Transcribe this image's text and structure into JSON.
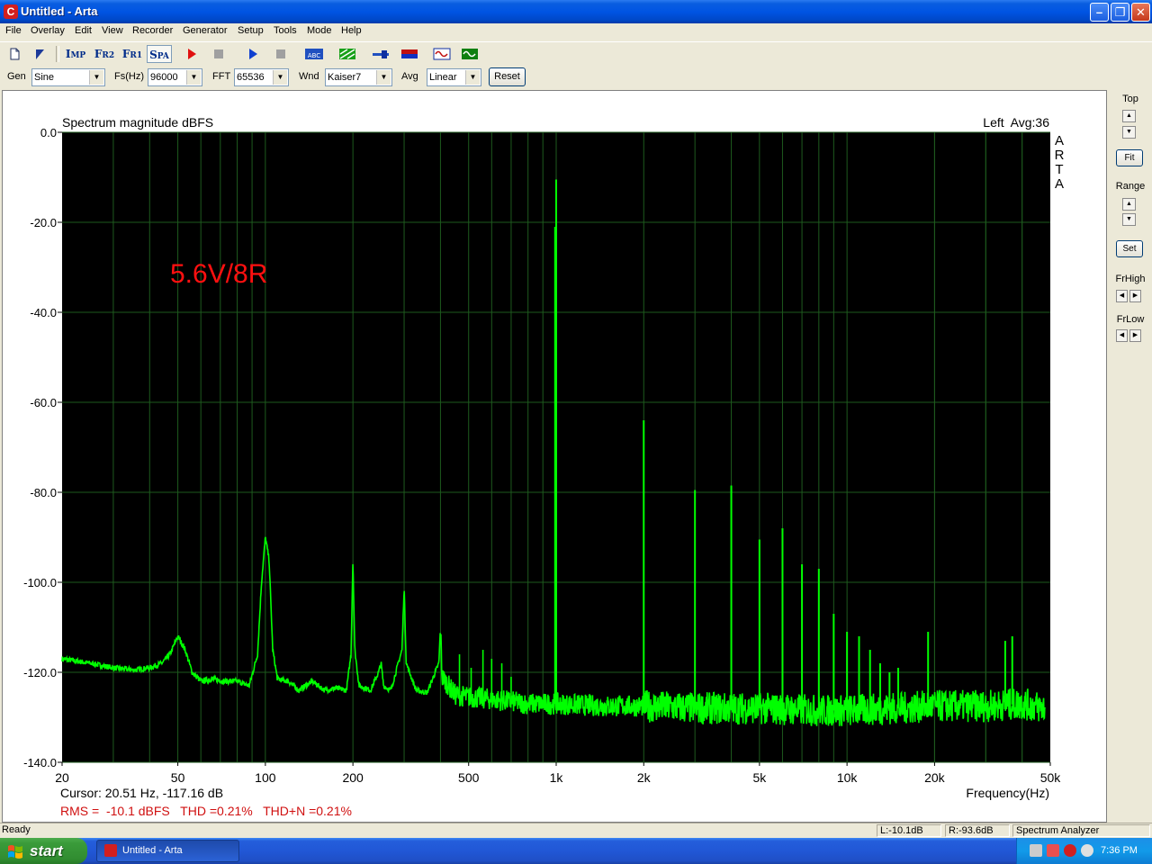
{
  "window": {
    "title": "Untitled - Arta",
    "app_icon_letter": "C",
    "minimize_glyph": "–",
    "maximize_glyph": "❐",
    "close_glyph": "✕"
  },
  "menu": [
    "File",
    "Overlay",
    "Edit",
    "View",
    "Recorder",
    "Generator",
    "Setup",
    "Tools",
    "Mode",
    "Help"
  ],
  "toolbar": {
    "imp": {
      "big": "I",
      "small": "MP"
    },
    "fr2": {
      "big": "F",
      "small": "R2"
    },
    "fr1": {
      "big": "F",
      "small": "R1"
    },
    "spa": {
      "big": "S",
      "small": "PA"
    }
  },
  "settings": {
    "gen_label": "Gen",
    "gen_value": "Sine",
    "fs_label": "Fs(Hz)",
    "fs_value": "96000",
    "fft_label": "FFT",
    "fft_value": "65536",
    "wnd_label": "Wnd",
    "wnd_value": "Kaiser7",
    "avg_label": "Avg",
    "avg_value": "Linear",
    "reset_label": "Reset",
    "combo_arrow": "▼"
  },
  "right_panel": {
    "top_label": "Top",
    "fit_label": "Fit",
    "range_label": "Range",
    "set_label": "Set",
    "frhigh_label": "FrHigh",
    "frlow_label": "FrLow",
    "up": "▲",
    "down": "▼",
    "left": "◀",
    "right": "▶"
  },
  "chart_data": {
    "type": "line",
    "title": "Spectrum magnitude dBFS",
    "channel_info": "Left  Avg:36",
    "watermark": [
      "A",
      "R",
      "T",
      "A"
    ],
    "annotation": "5.6V/8R",
    "xlabel": "Frequency(Hz)",
    "x_scale": "log",
    "xlim": [
      20,
      50000
    ],
    "ylim": [
      -140,
      0
    ],
    "x_tick_values": [
      20,
      50,
      100,
      200,
      500,
      1000,
      2000,
      5000,
      10000,
      20000,
      50000
    ],
    "x_tick_labels": [
      "20",
      "50",
      "100",
      "200",
      "500",
      "1k",
      "2k",
      "5k",
      "10k",
      "20k",
      "50k"
    ],
    "y_tick_values": [
      0,
      -20,
      -40,
      -60,
      -80,
      -100,
      -120,
      -140
    ],
    "y_tick_labels": [
      "0.0",
      "-20.0",
      "-40.0",
      "-60.0",
      "-80.0",
      "-100.0",
      "-120.0",
      "-140.0"
    ],
    "cursor_text": "Cursor: 20.51 Hz, -117.16 dB",
    "measurement_text": "RMS =  -10.1 dBFS   THD =0.21%   THD+N =0.21%",
    "grid": true,
    "series": [
      {
        "color": "#00ff00",
        "x": [
          20,
          25,
          30,
          35,
          40,
          44,
          47,
          50,
          53,
          56,
          60,
          66,
          72,
          80,
          88,
          94,
          97,
          100,
          103,
          106,
          110,
          120,
          130,
          145,
          160,
          175,
          190,
          197,
          200,
          203,
          210,
          230,
          245,
          250,
          255,
          270,
          295,
          300,
          305,
          330,
          360,
          395,
          400,
          405,
          450,
          500,
          600,
          700,
          800,
          900,
          1000,
          1500,
          2000,
          3000,
          5000,
          8000,
          10000,
          15000,
          20000,
          30000,
          40000,
          48000
        ],
        "y": [
          -117,
          -118,
          -119,
          -119.5,
          -119,
          -118,
          -116,
          -112,
          -115,
          -120,
          -122,
          -121.5,
          -122,
          -122,
          -123,
          -116,
          -100,
          -90,
          -95,
          -115,
          -121.5,
          -122,
          -124,
          -122,
          -124,
          -123.5,
          -124,
          -116,
          -95,
          -115,
          -123,
          -124,
          -120,
          -118,
          -123,
          -124,
          -115,
          -101,
          -118,
          -124,
          -124.5,
          -118,
          -110,
          -121,
          -125,
          -125.5,
          -126,
          -126.5,
          -127,
          -127,
          -127,
          -127.5,
          -127.5,
          -128,
          -128,
          -128.5,
          -128.5,
          -128,
          -127.5,
          -127.5,
          -127,
          -128
        ]
      }
    ],
    "spikes": {
      "x": [
        1000,
        2000,
        3000,
        4000,
        5000,
        6000,
        7000,
        8000,
        9000,
        10000,
        11000,
        12000,
        13000,
        14000,
        15000,
        19000,
        35000,
        37000
      ],
      "y": [
        -10.5,
        -64,
        -79.5,
        -78.5,
        -90.5,
        -88,
        -96,
        -97,
        -107,
        -111,
        -112,
        -115,
        -118,
        -120,
        -119,
        -111,
        -113,
        -112
      ]
    },
    "small_spikes": {
      "x": [
        420,
        465,
        510,
        560,
        600,
        650,
        700
      ],
      "y": [
        -121,
        -116,
        -119,
        -115,
        -117,
        -118,
        -121
      ]
    }
  },
  "statusbar": {
    "ready": "Ready",
    "left_level": "L:-10.1dB",
    "right_level": "R:-93.6dB",
    "mode": "Spectrum Analyzer"
  },
  "taskbar": {
    "start": "start",
    "task_title": "Untitled - Arta",
    "clock": "7:36 PM"
  }
}
